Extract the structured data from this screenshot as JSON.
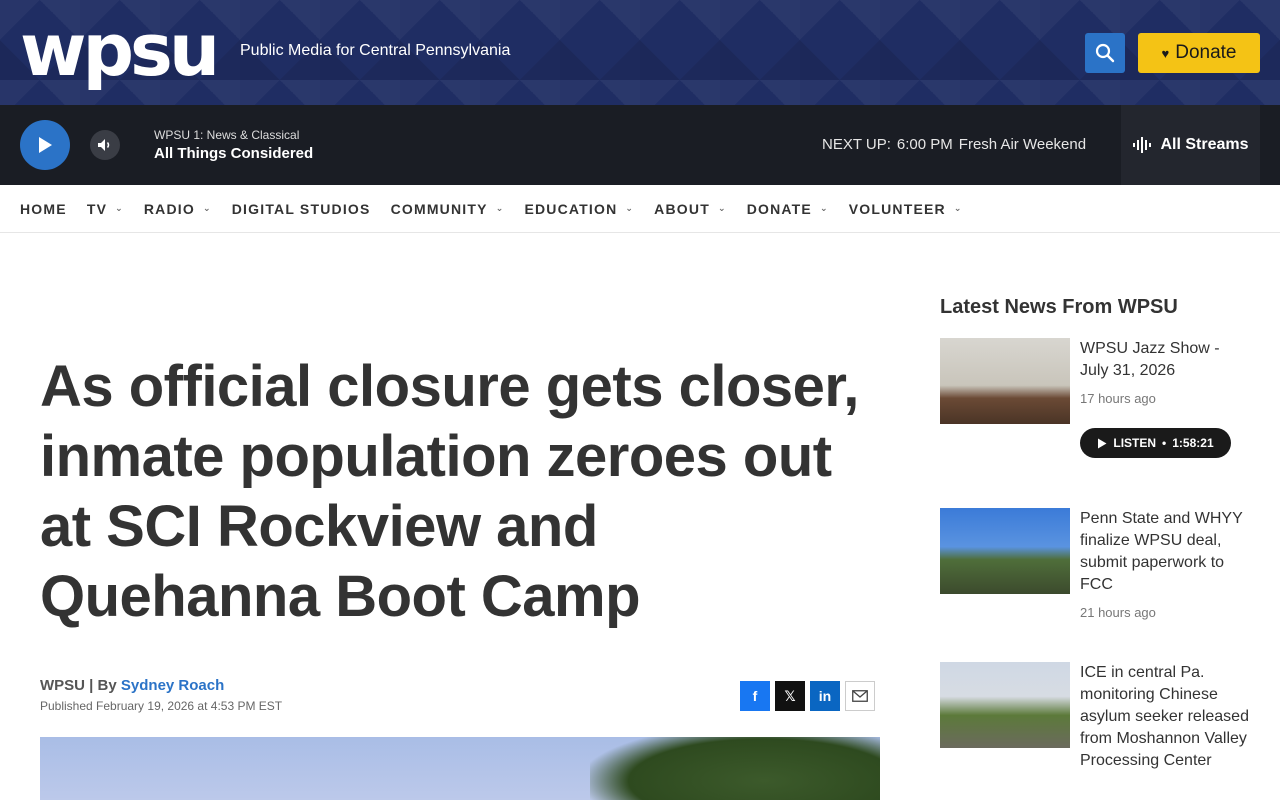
{
  "header": {
    "logo_text": "wpsu",
    "tagline": "Public Media for Central Pennsylvania",
    "donate_label": "Donate",
    "brand_color": "#1f2d63",
    "accent_color": "#f4c315"
  },
  "player": {
    "station": "WPSU 1: News & Classical",
    "program": "All Things Considered",
    "next_up_label": "NEXT UP:",
    "next_up_time": "6:00 PM",
    "next_up_show": "Fresh Air Weekend",
    "streams_label": "All Streams"
  },
  "nav": {
    "items": [
      {
        "label": "HOME",
        "has_menu": false
      },
      {
        "label": "TV",
        "has_menu": true
      },
      {
        "label": "RADIO",
        "has_menu": true
      },
      {
        "label": "DIGITAL STUDIOS",
        "has_menu": false
      },
      {
        "label": "COMMUNITY",
        "has_menu": true
      },
      {
        "label": "EDUCATION",
        "has_menu": true
      },
      {
        "label": "ABOUT",
        "has_menu": true
      },
      {
        "label": "DONATE",
        "has_menu": true
      },
      {
        "label": "VOLUNTEER",
        "has_menu": true
      }
    ]
  },
  "article": {
    "headline": "As official closure gets closer, inmate population zeroes out at SCI Rockview and Quehanna Boot Camp",
    "source": "WPSU | By",
    "author": "Sydney Roach",
    "published": "Published February 19, 2026 at 4:53 PM EST"
  },
  "share": {
    "facebook": "f",
    "x": "𝕏",
    "linkedin": "in",
    "email_icon": "envelope-icon"
  },
  "sidebar": {
    "title": "Latest News From WPSU",
    "items": [
      {
        "title": "WPSU Jazz Show - July 31, 2026",
        "time": "17 hours ago",
        "listen_label": "LISTEN",
        "duration": "1:58:21"
      },
      {
        "title": "Penn State and WHYY finalize WPSU deal, submit paperwork to FCC",
        "time": "21 hours ago"
      },
      {
        "title": "ICE in central Pa. monitoring Chinese asylum seeker released from Moshannon Valley Processing Center",
        "time": ""
      }
    ]
  }
}
